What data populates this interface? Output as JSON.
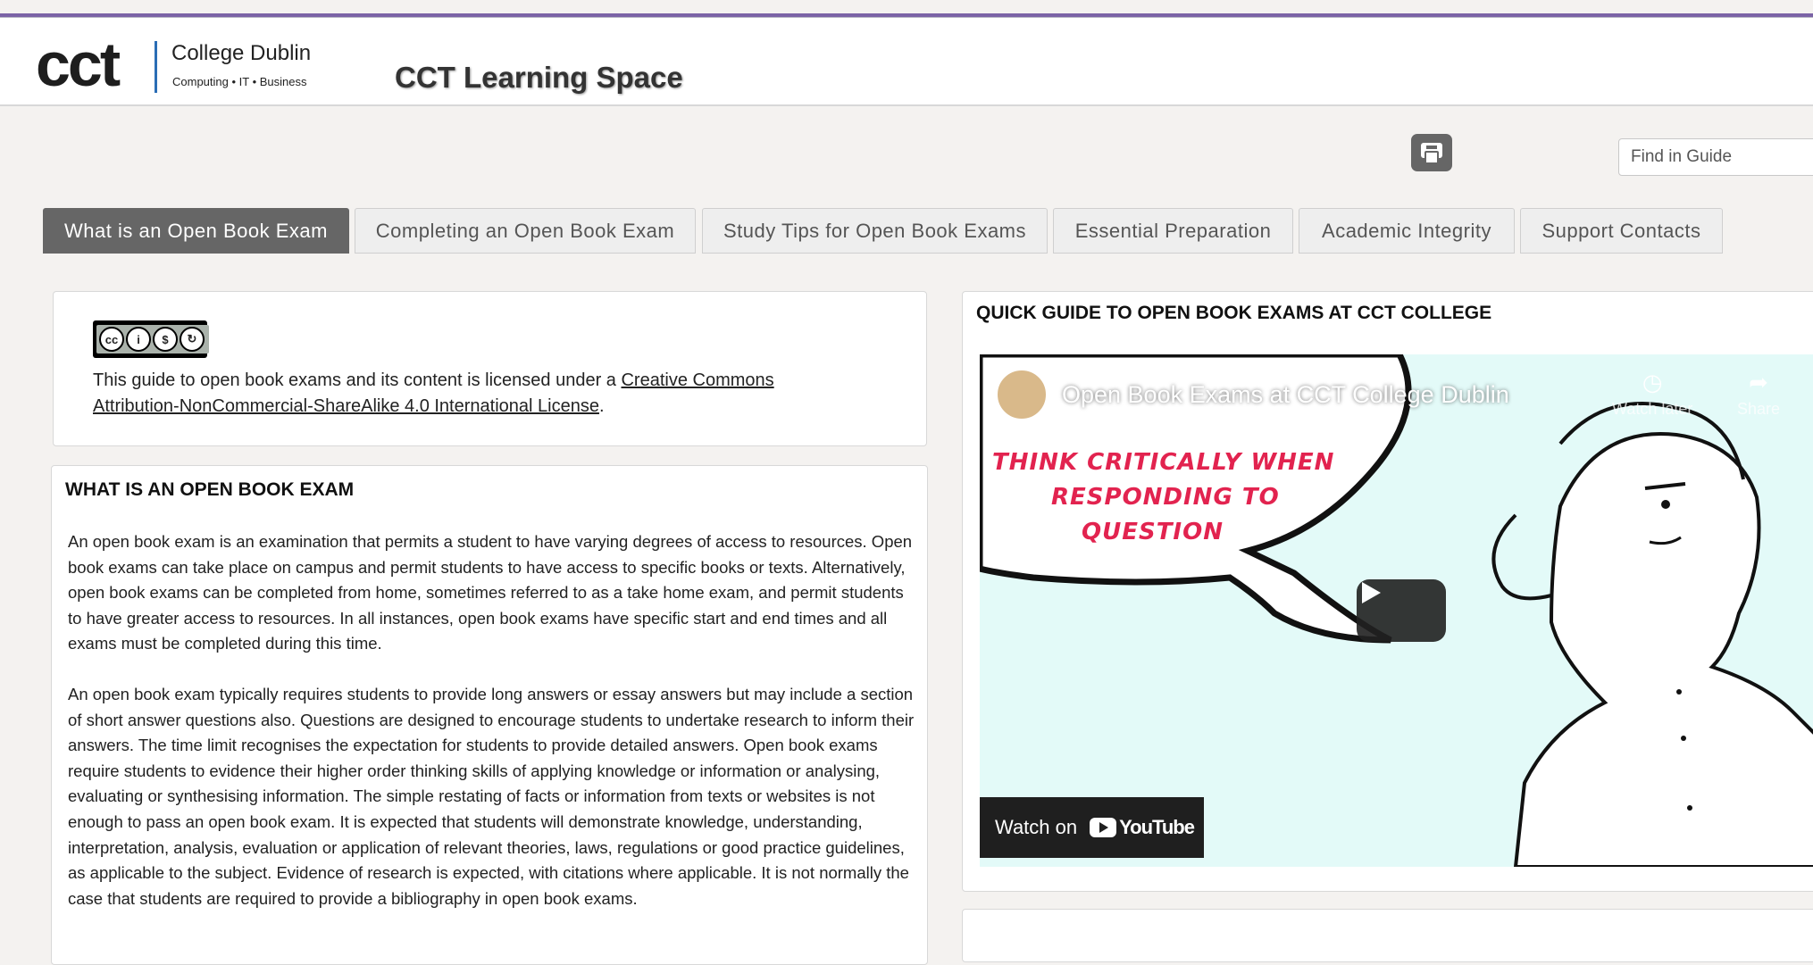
{
  "header": {
    "logo_text": "cct",
    "logo_line1": "College Dublin",
    "logo_line2": "Computing • IT • Business",
    "site_title": "CCT Learning Space"
  },
  "toolbar": {
    "print_icon": "print-icon",
    "search_placeholder": "Find in Guide"
  },
  "tabs": [
    {
      "label": "What is an Open Book Exam",
      "active": true
    },
    {
      "label": "Completing an Open Book Exam"
    },
    {
      "label": "Study Tips for Open Book Exams"
    },
    {
      "label": "Essential Preparation"
    },
    {
      "label": "Academic Integrity"
    },
    {
      "label": "Support Contacts"
    }
  ],
  "license": {
    "badge_icon": "cc-by-nc-sa-badge",
    "badge_text": "BY NC SA",
    "text_before": "This guide to open book exams and its content is licensed under a ",
    "link_text": "Creative Commons Attribution-NonCommercial-ShareAlike 4.0 International License",
    "text_after": "."
  },
  "what_is": {
    "heading": "WHAT IS AN OPEN BOOK EXAM",
    "paragraph1": "An open book exam is an examination that permits a student to have varying degrees of access to resources. Open book exams can take place on campus and permit students to have access to specific books or texts. Alternatively, open book exams can be completed from home, sometimes referred to as a take home exam, and permit students to have greater access to resources. In all instances, open book exams have specific start and end times and all exams must be completed during this time.",
    "paragraph2": "An open book exam typically requires students to provide long answers or essay answers but may include a section of short answer questions also. Questions are designed to encourage students to undertake research to inform their answers. The time limit recognises the expectation for students to provide detailed answers. Open book exams require students to evidence their higher order thinking skills of applying knowledge or information or analysing, evaluating or synthesising information. The simple restating of facts or information from texts or websites is not enough to pass an open book exam. It is expected that students will demonstrate knowledge, understanding, interpretation, analysis, evaluation or application of relevant theories, laws, regulations or good practice guidelines, as applicable to the subject. Evidence of research is expected, with citations where applicable. It is not normally the case that students are required to provide a bibliography in open book exams."
  },
  "quick_guide": {
    "heading": "QUICK GUIDE TO OPEN BOOK EXAMS AT CCT COLLEGE",
    "video": {
      "title": "Open Book Exams at CCT College Dublin",
      "watch_later": "Watch later",
      "share": "Share",
      "bubble_text": [
        "THINK CRITICALLY WHEN",
        "RESPONDING TO",
        "QUESTION"
      ],
      "watch_on": "Watch on",
      "youtube": "YouTube"
    }
  }
}
